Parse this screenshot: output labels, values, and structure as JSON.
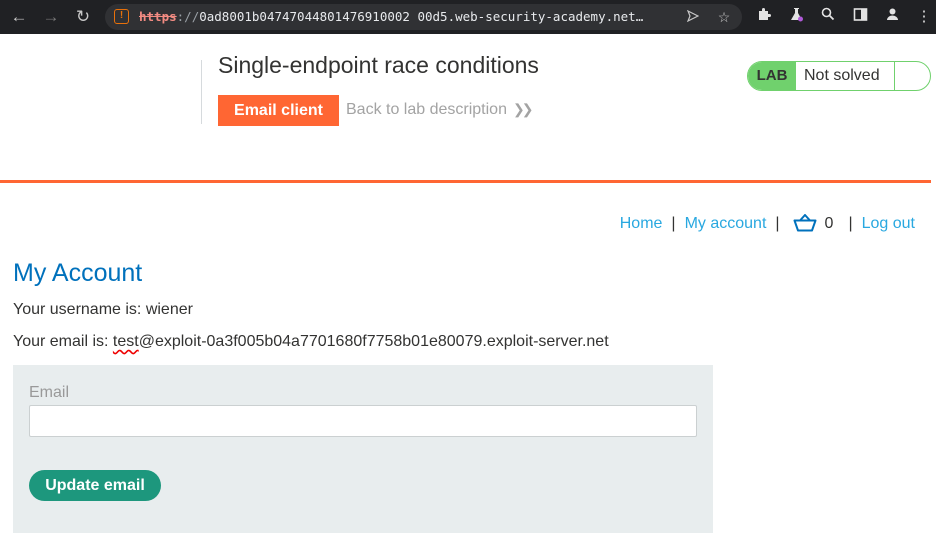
{
  "browser": {
    "url_scheme": "https",
    "url_sep": "://",
    "url_host": "0ad8001b04747044801476910002 00d5.web-security-academy.net…",
    "back_icon": "←",
    "forward_icon": "→",
    "reload_icon": "↻"
  },
  "lab": {
    "title": "Single-endpoint race conditions",
    "email_client_label": "Email client",
    "back_link_label": "Back to lab description",
    "badge": "LAB",
    "status": "Not solved"
  },
  "nav": {
    "home": "Home",
    "my_account": "My account",
    "cart_count": "0",
    "log_out": "Log out",
    "separator": "|"
  },
  "account": {
    "heading": "My Account",
    "username_prefix": "Your username is: ",
    "username": "wiener",
    "email_prefix": "Your email is: ",
    "email_user": "test",
    "email_domain": "@exploit-0a3f005b04a7701680f7758b01e80079.exploit-server.net",
    "form": {
      "email_label": "Email",
      "email_value": "",
      "email_placeholder": "",
      "submit_label": "Update email"
    }
  },
  "colors": {
    "accent": "#ff6633",
    "link": "#29a8e0",
    "heading": "#0071bc",
    "lab_green": "#70d16d",
    "button_green": "#1d977d"
  }
}
